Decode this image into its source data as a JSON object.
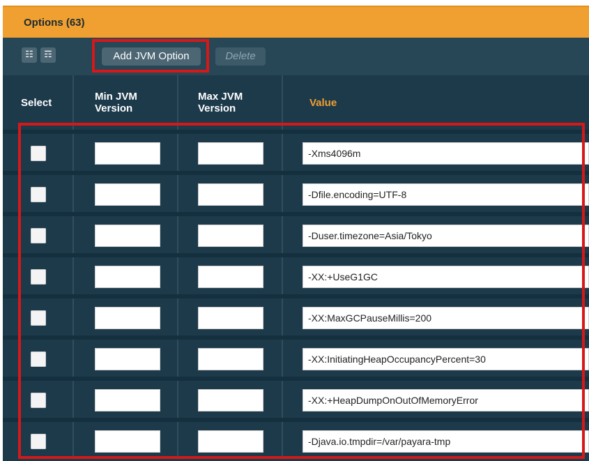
{
  "title": "Options (63)",
  "toolbar": {
    "select_all_icon": "select-all-icon",
    "deselect_icon": "deselect-icon",
    "add_label": "Add JVM Option",
    "delete_label": "Delete"
  },
  "columns": {
    "select": "Select",
    "min": "Min JVM Version",
    "max": "Max JVM Version",
    "value": "Value"
  },
  "rows": [
    {
      "min": "",
      "max": "",
      "value": "-Xms4096m"
    },
    {
      "min": "",
      "max": "",
      "value": "-Dfile.encoding=UTF-8"
    },
    {
      "min": "",
      "max": "",
      "value": "-Duser.timezone=Asia/Tokyo"
    },
    {
      "min": "",
      "max": "",
      "value": "-XX:+UseG1GC"
    },
    {
      "min": "",
      "max": "",
      "value": "-XX:MaxGCPauseMillis=200"
    },
    {
      "min": "",
      "max": "",
      "value": "-XX:InitiatingHeapOccupancyPercent=30"
    },
    {
      "min": "",
      "max": "",
      "value": "-XX:+HeapDumpOnOutOfMemoryError"
    },
    {
      "min": "",
      "max": "",
      "value": "-Djava.io.tmpdir=/var/payara-tmp"
    }
  ],
  "colors": {
    "accent": "#f0a030",
    "panel_bg": "#1d3a4b",
    "highlight": "#d61818"
  }
}
